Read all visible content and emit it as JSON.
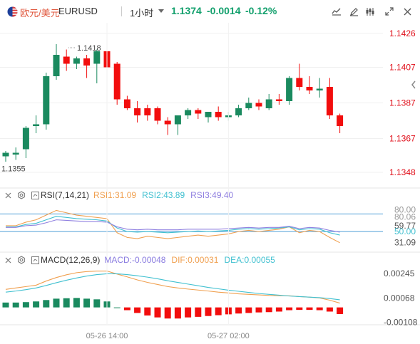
{
  "header": {
    "pair_cn": "欧元/美元",
    "symbol": "EURUSD",
    "interval": "1小时",
    "last_price": "1.1374",
    "change": "-0.0014",
    "change_pct": "-0.12%",
    "buttons": [
      "draw-tool-icon",
      "edit-icon",
      "candle-style-icon",
      "fullscreen-icon",
      "close-icon"
    ]
  },
  "colors": {
    "up": "#1a8a5f",
    "down": "#f20d0d",
    "price_text": "#e00f1a",
    "rsi1": "#f0a050",
    "rsi2": "#40c0d0",
    "rsi3": "#9080e0",
    "macd": "#8a7ce0",
    "dif": "#f0a050",
    "dea": "#40c0d0"
  },
  "chart_data": [
    {
      "type": "candlestick",
      "name": "EURUSD 1H",
      "ylim": [
        1.134,
        1.1432
      ],
      "y_ticks": [
        "1.1426",
        "1.1407",
        "1.1387",
        "1.1367",
        "1.1348"
      ],
      "y_tick_values": [
        1.1426,
        1.1407,
        1.1387,
        1.1367,
        1.1348
      ],
      "x_ticks": [
        "05-26 14:00",
        "05-27 02:00"
      ],
      "x_tick_index": [
        10,
        22
      ],
      "annotations": {
        "high_label": "1.1418",
        "low_label": "1.1355"
      },
      "candles": [
        {
          "o": 1.1357,
          "h": 1.136,
          "l": 1.1354,
          "c": 1.1359
        },
        {
          "o": 1.1358,
          "h": 1.1362,
          "l": 1.1355,
          "c": 1.1359
        },
        {
          "o": 1.1361,
          "h": 1.1374,
          "l": 1.1356,
          "c": 1.1373
        },
        {
          "o": 1.1374,
          "h": 1.138,
          "l": 1.137,
          "c": 1.1375
        },
        {
          "o": 1.1375,
          "h": 1.1404,
          "l": 1.1372,
          "c": 1.1402
        },
        {
          "o": 1.1402,
          "h": 1.142,
          "l": 1.14,
          "c": 1.1414
        },
        {
          "o": 1.1413,
          "h": 1.1417,
          "l": 1.1405,
          "c": 1.1409
        },
        {
          "o": 1.1409,
          "h": 1.1413,
          "l": 1.1406,
          "c": 1.1412
        },
        {
          "o": 1.1412,
          "h": 1.1414,
          "l": 1.1401,
          "c": 1.1408
        },
        {
          "o": 1.1409,
          "h": 1.1417,
          "l": 1.1398,
          "c": 1.1416
        },
        {
          "o": 1.1416,
          "h": 1.1418,
          "l": 1.1406,
          "c": 1.1407
        },
        {
          "o": 1.1409,
          "h": 1.141,
          "l": 1.1386,
          "c": 1.1389
        },
        {
          "o": 1.1389,
          "h": 1.1391,
          "l": 1.1383,
          "c": 1.1384
        },
        {
          "o": 1.1384,
          "h": 1.1388,
          "l": 1.1376,
          "c": 1.138
        },
        {
          "o": 1.1384,
          "h": 1.1386,
          "l": 1.1377,
          "c": 1.138
        },
        {
          "o": 1.1384,
          "h": 1.1385,
          "l": 1.1375,
          "c": 1.1377
        },
        {
          "o": 1.1377,
          "h": 1.1379,
          "l": 1.1369,
          "c": 1.1375
        },
        {
          "o": 1.1375,
          "h": 1.138,
          "l": 1.1369,
          "c": 1.138
        },
        {
          "o": 1.138,
          "h": 1.1384,
          "l": 1.1378,
          "c": 1.1383
        },
        {
          "o": 1.1383,
          "h": 1.1384,
          "l": 1.1378,
          "c": 1.1381
        },
        {
          "o": 1.1379,
          "h": 1.1382,
          "l": 1.1376,
          "c": 1.1382
        },
        {
          "o": 1.1382,
          "h": 1.1385,
          "l": 1.1377,
          "c": 1.1379
        },
        {
          "o": 1.1379,
          "h": 1.1382,
          "l": 1.1377,
          "c": 1.138
        },
        {
          "o": 1.138,
          "h": 1.1386,
          "l": 1.1379,
          "c": 1.1384
        },
        {
          "o": 1.1384,
          "h": 1.139,
          "l": 1.1383,
          "c": 1.1387
        },
        {
          "o": 1.1387,
          "h": 1.1389,
          "l": 1.1383,
          "c": 1.1385
        },
        {
          "o": 1.1384,
          "h": 1.1392,
          "l": 1.1383,
          "c": 1.1389
        },
        {
          "o": 1.1389,
          "h": 1.1392,
          "l": 1.1386,
          "c": 1.1388
        },
        {
          "o": 1.1388,
          "h": 1.1402,
          "l": 1.1386,
          "c": 1.1401
        },
        {
          "o": 1.1401,
          "h": 1.1409,
          "l": 1.1394,
          "c": 1.1396
        },
        {
          "o": 1.1396,
          "h": 1.1402,
          "l": 1.1392,
          "c": 1.1394
        },
        {
          "o": 1.1394,
          "h": 1.1401,
          "l": 1.139,
          "c": 1.1395
        },
        {
          "o": 1.1396,
          "h": 1.1401,
          "l": 1.1378,
          "c": 1.138
        },
        {
          "o": 1.138,
          "h": 1.1381,
          "l": 1.137,
          "c": 1.1374
        }
      ]
    },
    {
      "type": "line",
      "name": "RSI(7,14,21)",
      "ylim": [
        15,
        95
      ],
      "y_ticks": [
        "80.00",
        "80.06",
        "59.77",
        "50.00",
        "31.09"
      ],
      "y_tick_values": [
        80.0,
        80.06,
        59.77,
        50.0,
        31.09
      ],
      "ref_lines": [
        80,
        50
      ],
      "series": [
        {
          "name": "RSI1:31.09",
          "values": [
            60,
            60,
            66,
            70,
            78,
            86,
            82,
            78,
            76,
            74,
            72,
            48,
            40,
            38,
            42,
            40,
            38,
            40,
            42,
            44,
            42,
            44,
            46,
            50,
            52,
            50,
            52,
            54,
            58,
            48,
            52,
            50,
            40,
            31
          ]
        },
        {
          "name": "RSI2:43.89",
          "values": [
            58,
            58,
            62,
            64,
            70,
            76,
            74,
            72,
            71,
            70,
            68,
            56,
            50,
            49,
            50,
            49,
            48,
            49,
            50,
            51,
            50,
            51,
            52,
            54,
            55,
            54,
            55,
            56,
            58,
            53,
            55,
            54,
            48,
            44
          ]
        },
        {
          "name": "RSI3:49.40",
          "values": [
            57,
            57,
            60,
            61,
            65,
            70,
            69,
            68,
            67,
            67,
            66,
            58,
            54,
            53,
            54,
            53,
            53,
            53,
            54,
            54,
            54,
            54,
            55,
            56,
            57,
            56,
            57,
            57,
            59,
            55,
            57,
            56,
            52,
            49
          ]
        }
      ]
    },
    {
      "type": "bar",
      "name": "MACD(12,26,9)",
      "ylim": [
        -0.00125,
        0.00275
      ],
      "y_ticks": [
        "0.00245",
        "0.00068",
        "-0.00108"
      ],
      "y_tick_values": [
        0.00245,
        0.00068,
        -0.00108
      ],
      "macd_label": "MACD:-0.00048",
      "dif_label": "DIF:0.00031",
      "dea_label": "DEA:0.00055",
      "histogram": [
        0.00035,
        0.00035,
        0.00038,
        0.00043,
        0.00053,
        0.00063,
        0.00066,
        0.00068,
        0.00063,
        0.00058,
        0.00043,
        0.0,
        -0.0002,
        -0.0004,
        -0.00058,
        -0.00072,
        -0.0008,
        -0.0008,
        -0.00072,
        -0.00068,
        -0.00062,
        -0.00056,
        -0.0005,
        -0.00044,
        -0.0004,
        -0.00036,
        -0.00034,
        -0.0003,
        -0.0002,
        -0.00018,
        -0.00018,
        -0.0002,
        -0.0003,
        -0.00048
      ],
      "dif": [
        0.0013,
        0.0014,
        0.0015,
        0.0016,
        0.0019,
        0.00215,
        0.00235,
        0.0025,
        0.00258,
        0.00262,
        0.00262,
        0.0024,
        0.0022,
        0.00198,
        0.0018,
        0.00165,
        0.0015,
        0.0014,
        0.00132,
        0.00125,
        0.00118,
        0.0011,
        0.00104,
        0.00098,
        0.00094,
        0.0009,
        0.00086,
        0.00084,
        0.00084,
        0.00078,
        0.00074,
        0.00068,
        0.00052,
        0.00031
      ],
      "dea": [
        0.0011,
        0.00118,
        0.00128,
        0.0014,
        0.00158,
        0.00178,
        0.00196,
        0.00212,
        0.00226,
        0.00236,
        0.00242,
        0.00242,
        0.00236,
        0.00228,
        0.00218,
        0.00206,
        0.00192,
        0.0018,
        0.00168,
        0.00156,
        0.00144,
        0.00134,
        0.00124,
        0.00116,
        0.00108,
        0.001,
        0.00094,
        0.00088,
        0.00082,
        0.00078,
        0.00074,
        0.0007,
        0.00064,
        0.00055
      ]
    }
  ],
  "rsi_header": {
    "label": "RSI(7,14,21)",
    "rsi1": "RSI1:31.09",
    "rsi2": "RSI2:43.89",
    "rsi3": "RSI3:49.40"
  },
  "macd_header": {
    "label": "MACD(12,26,9)",
    "macd": "MACD:-0.00048",
    "dif": "DIF:0.00031",
    "dea": "DEA:0.00055"
  }
}
